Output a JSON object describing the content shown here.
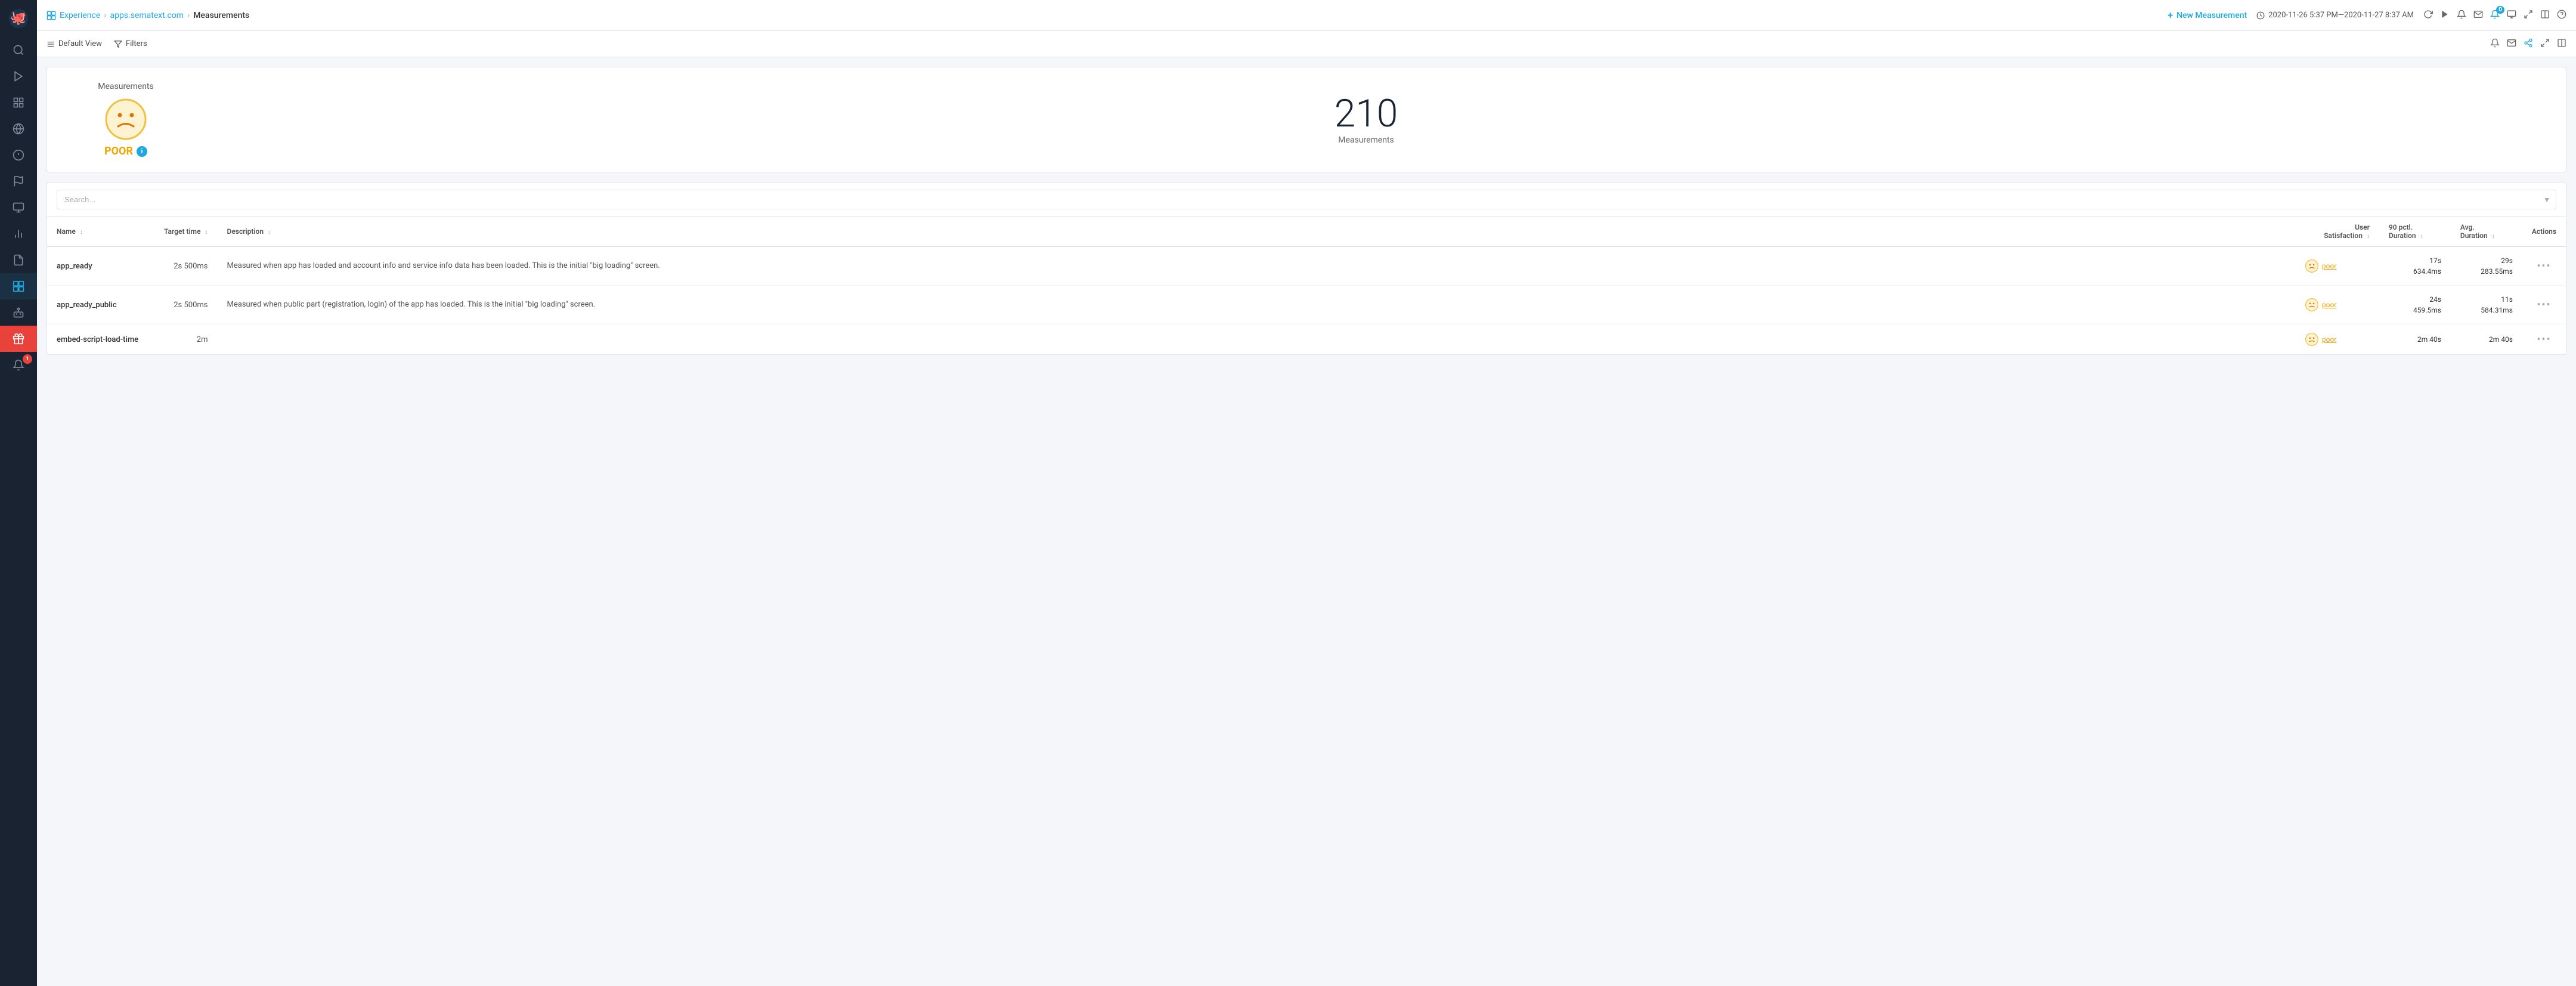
{
  "sidebar": {
    "logo_alt": "Sematext logo",
    "items": [
      {
        "id": "search",
        "icon": "🔍",
        "label": "Search",
        "active": false
      },
      {
        "id": "rocket",
        "icon": "🚀",
        "label": "Quick Start",
        "active": false
      },
      {
        "id": "apps",
        "icon": "⊞",
        "label": "Apps",
        "active": false
      },
      {
        "id": "globe",
        "icon": "🌐",
        "label": "Globe",
        "active": false
      },
      {
        "id": "alert",
        "icon": "⚠",
        "label": "Alerts",
        "active": false
      },
      {
        "id": "flag",
        "icon": "⚑",
        "label": "Flag",
        "active": false
      },
      {
        "id": "monitor",
        "icon": "🖥",
        "label": "Monitor",
        "active": false
      },
      {
        "id": "chart",
        "icon": "📊",
        "label": "Charts",
        "active": false
      },
      {
        "id": "doc",
        "icon": "📄",
        "label": "Docs",
        "active": false
      },
      {
        "id": "experience",
        "icon": "⊡",
        "label": "Experience",
        "active": true
      },
      {
        "id": "robot",
        "icon": "🤖",
        "label": "Robot",
        "active": false
      },
      {
        "id": "gift",
        "icon": "🎁",
        "label": "Gift",
        "active": false,
        "highlight": true
      },
      {
        "id": "bell",
        "icon": "🔔",
        "label": "Bell",
        "active": false,
        "badge": "1"
      }
    ]
  },
  "breadcrumb": {
    "experience_label": "Experience",
    "site_label": "apps.sematext.com",
    "current_label": "Measurements"
  },
  "topnav": {
    "new_measurement_label": "New Measurement",
    "datetime_range": "2020-11-26 5:37 PM—2020-11-27 8:37 AM",
    "notification_badge": "0"
  },
  "toolbar": {
    "default_view_label": "Default View",
    "filters_label": "Filters"
  },
  "summary": {
    "title": "Measurements",
    "status_label": "POOR",
    "count": "210",
    "count_label": "Measurements"
  },
  "search": {
    "placeholder": "Search..."
  },
  "table": {
    "headers": {
      "name": "Name",
      "target_time": "Target time",
      "description": "Description",
      "user_satisfaction": "User Satisfaction",
      "90_pctl_duration": "90 pctl. Duration",
      "avg_duration": "Avg. Duration",
      "actions": "Actions"
    },
    "rows": [
      {
        "name": "app_ready",
        "target_time": "2s 500ms",
        "description": "Measured when app has loaded and account info and service info data has been loaded. This is the initial \"big loading\" screen.",
        "user_satisfaction": "poor",
        "duration_90": "17s\n634.4ms",
        "duration_avg": "29s\n283.55ms"
      },
      {
        "name": "app_ready_public",
        "target_time": "2s 500ms",
        "description": "Measured when public part (registration, login) of the app has loaded. This is the initial \"big loading\" screen.",
        "user_satisfaction": "poor",
        "duration_90": "24s\n459.5ms",
        "duration_avg": "11s\n584.31ms"
      },
      {
        "name": "embed-script-load-time",
        "target_time": "2m",
        "description": "",
        "user_satisfaction": "poor",
        "duration_90": "2m 40s",
        "duration_avg": "2m 40s"
      }
    ]
  },
  "colors": {
    "accent_blue": "#1da8e0",
    "sidebar_bg": "#1a2332",
    "poor_color": "#f0a500",
    "danger_red": "#e8423b"
  }
}
